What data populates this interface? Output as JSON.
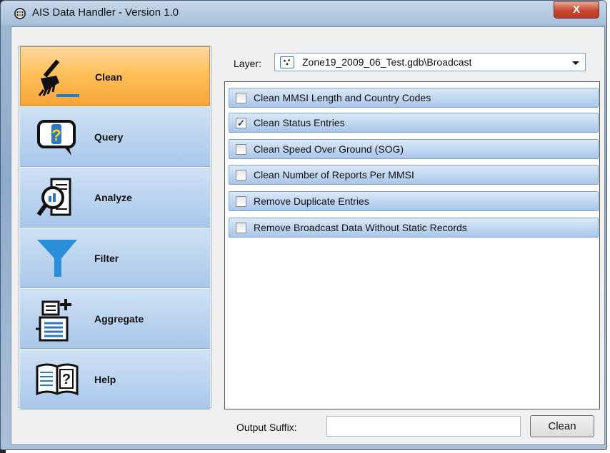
{
  "window": {
    "title": "AIS Data Handler - Version 1.0",
    "close_glyph": "X"
  },
  "nav": {
    "items": [
      {
        "label": "Clean",
        "icon": "broom-icon",
        "active": true
      },
      {
        "label": "Query",
        "icon": "question-bubble-icon",
        "active": false
      },
      {
        "label": "Analyze",
        "icon": "magnify-document-icon",
        "active": false
      },
      {
        "label": "Filter",
        "icon": "funnel-icon",
        "active": false
      },
      {
        "label": "Aggregate",
        "icon": "add-documents-icon",
        "active": false
      },
      {
        "label": "Help",
        "icon": "help-book-icon",
        "active": false
      }
    ]
  },
  "layer": {
    "label": "Layer:",
    "value": "Zone19_2009_06_Test.gdb\\Broadcast",
    "icon": "point-layer-icon"
  },
  "options": [
    {
      "label": "Clean MMSI Length and Country Codes",
      "checked": false
    },
    {
      "label": "Clean Status Entries",
      "checked": true
    },
    {
      "label": "Clean Speed Over Ground (SOG)",
      "checked": false
    },
    {
      "label": "Clean Number of Reports Per MMSI",
      "checked": false
    },
    {
      "label": "Remove Duplicate Entries",
      "checked": false
    },
    {
      "label": "Remove Broadcast Data Without Static Records",
      "checked": false
    }
  ],
  "footer": {
    "suffix_label": "Output Suffix:",
    "suffix_value": "",
    "action_label": "Clean"
  },
  "colors": {
    "active_tab": "#ffc05a",
    "tab": "#a9c7ea",
    "option_row": "#a8c6ea",
    "close_button": "#c7452d"
  }
}
